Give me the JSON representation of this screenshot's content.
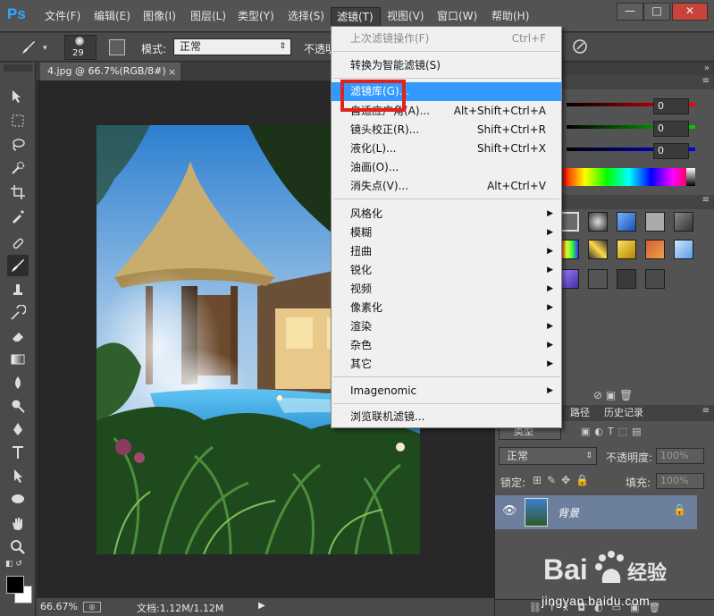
{
  "app": {
    "logo": "Ps"
  },
  "menubar": {
    "items": [
      "文件(F)",
      "编辑(E)",
      "图像(I)",
      "图层(L)",
      "类型(Y)",
      "选择(S)",
      "滤镜(T)",
      "视图(V)",
      "窗口(W)",
      "帮助(H)"
    ],
    "active": "滤镜(T)"
  },
  "window_controls": {
    "minimize": "—",
    "maximize": "□",
    "close": "✕"
  },
  "options_bar": {
    "brush_size": "29",
    "mode_label": "模式:",
    "mode_value": "正常",
    "opacity_label": "不透明"
  },
  "document": {
    "tab_title": "4.jpg @ 66.7%(RGB/8#)",
    "close": "×"
  },
  "status_bar": {
    "zoom": "66.67%",
    "doc_info": "文档:1.12M/1.12M"
  },
  "color_panel": {
    "r": "0",
    "g": "0",
    "b": "0"
  },
  "layers_panel": {
    "tabs": [
      "路径",
      "历史记录"
    ],
    "kind_label": "类型",
    "blend_mode": "正常",
    "opacity_label": "不透明度:",
    "opacity_value": "100%",
    "lock_label": "锁定:",
    "fill_label": "填充:",
    "fill_value": "100%",
    "layer_name": "背景"
  },
  "filter_menu": {
    "items": [
      {
        "label": "上次滤镜操作(F)",
        "shortcut": "Ctrl+F",
        "disabled": true
      },
      {
        "label": "转换为智能滤镜(S)"
      },
      {
        "label": "滤镜库(G)...",
        "highlighted": true
      },
      {
        "label": "自适应广角(A)...",
        "shortcut": "Alt+Shift+Ctrl+A"
      },
      {
        "label": "镜头校正(R)...",
        "shortcut": "Shift+Ctrl+R"
      },
      {
        "label": "液化(L)...",
        "shortcut": "Shift+Ctrl+X"
      },
      {
        "label": "油画(O)..."
      },
      {
        "label": "消失点(V)...",
        "shortcut": "Alt+Ctrl+V"
      },
      {
        "label": "风格化",
        "submenu": true
      },
      {
        "label": "模糊",
        "submenu": true
      },
      {
        "label": "扭曲",
        "submenu": true
      },
      {
        "label": "锐化",
        "submenu": true
      },
      {
        "label": "视频",
        "submenu": true
      },
      {
        "label": "像素化",
        "submenu": true
      },
      {
        "label": "渲染",
        "submenu": true
      },
      {
        "label": "杂色",
        "submenu": true
      },
      {
        "label": "其它",
        "submenu": true
      },
      {
        "label": "Imagenomic",
        "submenu": true
      },
      {
        "label": "浏览联机滤镜..."
      }
    ]
  },
  "watermark": {
    "text": "jingyan.baidu.com",
    "logo": "Bai 经验"
  },
  "colors": {
    "accent": "#3399ff",
    "highlight_box": "#e0231c"
  }
}
